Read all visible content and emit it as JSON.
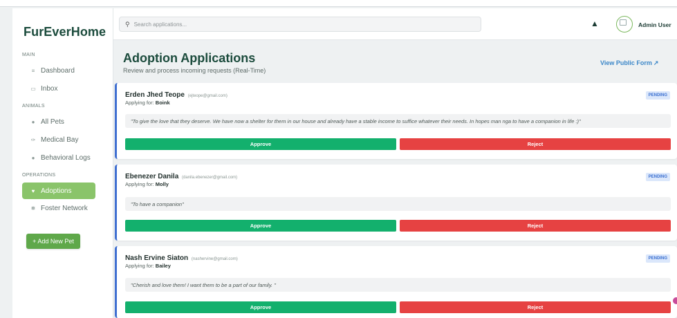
{
  "sidebar": {
    "brand": "FurEverHome",
    "sections": [
      {
        "label": "MAIN",
        "items": [
          {
            "label": "Dashboard",
            "icon": "chart-icon"
          },
          {
            "label": "Inbox",
            "icon": "inbox-icon"
          }
        ]
      },
      {
        "label": "ANIMALS",
        "items": [
          {
            "label": "All Pets",
            "icon": "paw-icon"
          },
          {
            "label": "Medical Bay",
            "icon": "medical-icon"
          },
          {
            "label": "Behavioral Logs",
            "icon": "brain-icon"
          }
        ]
      },
      {
        "label": "OPERATIONS",
        "items": [
          {
            "label": "Adoptions",
            "icon": "heart-icon",
            "active": true
          },
          {
            "label": "Foster Network",
            "icon": "network-icon"
          }
        ]
      }
    ],
    "add_button": "+ Add New Pet"
  },
  "header": {
    "search_placeholder": "Search applications...",
    "user_name": "Admin User"
  },
  "page": {
    "title": "Adoption Applications",
    "subtitle": "Review and process incoming requests (Real-Time)",
    "public_form_link": "View Public Form"
  },
  "applications": [
    {
      "name": "Erden Jhed Teope",
      "email": "(ejteope@gmail.com)",
      "applying_label": "Applying for:",
      "pet": "Boink",
      "status": "PENDING",
      "message": "\"To give the love that they deserve. We have now a shelter for them in our house and already have a stable income to suffice whatever their needs. In hopes man nga to have a companion in life :)\"",
      "approve_label": "Approve",
      "reject_label": "Reject"
    },
    {
      "name": "Ebenezer Danila",
      "email": "(danila.ebenezer@gmail.com)",
      "applying_label": "Applying for:",
      "pet": "Molly",
      "status": "PENDING",
      "message": "\"To have a companion\"",
      "approve_label": "Approve",
      "reject_label": "Reject"
    },
    {
      "name": "Nash Ervine Siaton",
      "email": "(nashervine@gmail.com)",
      "applying_label": "Applying for:",
      "pet": "Bailey",
      "status": "PENDING",
      "message": "\"Cherish and love them! I want them to be a part of our family. \"",
      "approve_label": "Approve",
      "reject_label": "Reject"
    }
  ],
  "colors": {
    "brand": "#1b4b3c",
    "active_nav": "#8ac46a",
    "approve": "#13b06d",
    "reject": "#e64242",
    "card_accent": "#3f6fd1",
    "link": "#3a86c8"
  }
}
